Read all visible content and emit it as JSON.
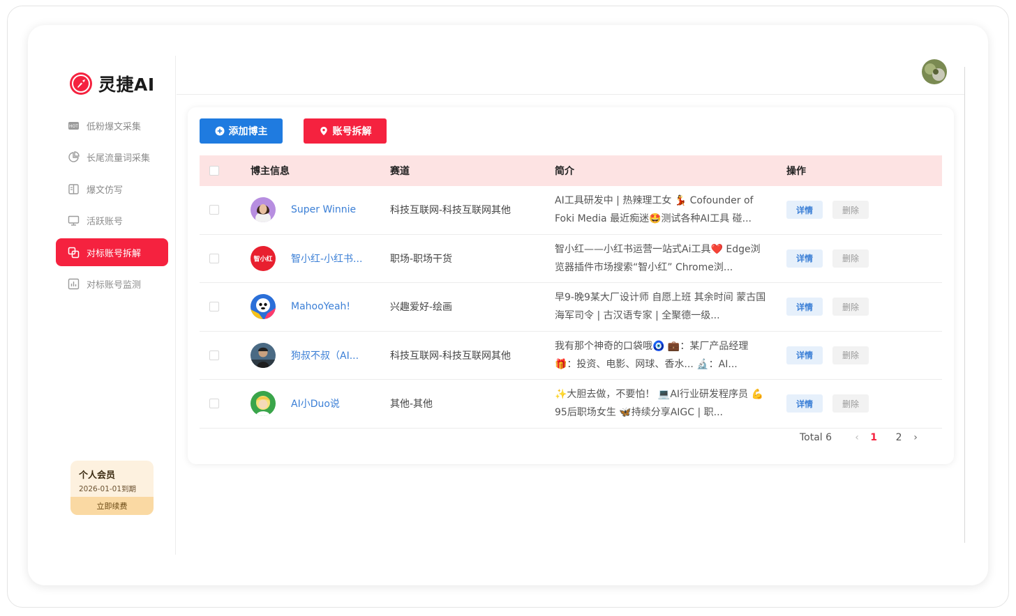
{
  "app": {
    "logo_text": "灵捷AI",
    "brand_color": "#f5223f"
  },
  "sidebar": {
    "items": [
      {
        "label": "低粉爆文采集",
        "icon": "hot-tag-icon",
        "active": false
      },
      {
        "label": "长尾流量词采集",
        "icon": "pie-chart-icon",
        "active": false
      },
      {
        "label": "爆文仿写",
        "icon": "book-edit-icon",
        "active": false
      },
      {
        "label": "活跃账号",
        "icon": "monitor-icon",
        "active": false
      },
      {
        "label": "对标账号拆解",
        "icon": "copy-split-icon",
        "active": true
      },
      {
        "label": "对标账号监测",
        "icon": "bar-chart-icon",
        "active": false
      }
    ],
    "member": {
      "title": "个人会员",
      "expire": "2026-01-01到期",
      "renew_label": "立即续费"
    }
  },
  "toolbar": {
    "add_label": "添加博主",
    "split_label": "账号拆解"
  },
  "table": {
    "headers": {
      "info": "博主信息",
      "track": "赛道",
      "bio": "简介",
      "ops": "操作"
    },
    "detail_label": "详情",
    "delete_label": "删除",
    "rows": [
      {
        "name": "Super Winnie",
        "track": "科技互联网-科技互联网其他",
        "bio": "AI工具研发中 | 热辣理工女 💃 Cofounder of Foki Media 最近痴迷🤩测试各种AI工具 碰..."
      },
      {
        "name": "智小红-小红书...",
        "track": "职场-职场干货",
        "bio": "智小红——小红书运营一站式Ai工具❤️ Edge浏览器插件市场搜索“智小红” Chrome浏..."
      },
      {
        "name": "MahooYeah!",
        "track": "兴趣爱好-绘画",
        "bio": "早9-晚9某大厂设计师 自愿上班 其余时间 蒙古国海军司令 | 古汉语专家 | 全聚德一级..."
      },
      {
        "name": "狗叔不叔（AI...",
        "track": "科技互联网-科技互联网其他",
        "bio": "我有那个神奇的口袋哦🧿 💼：某厂产品经理 🎁：投资、电影、网球、香水... 🔬：AI..."
      },
      {
        "name": "AI小Duo说",
        "track": "其他-其他",
        "bio": "✨大胆去做，不要怕！ 💻AI行业研发程序员 💪95后职场女生 🦋持续分享AIGC | 职..."
      }
    ],
    "avatar_badge_text": "智小红"
  },
  "pagination": {
    "total_label": "Total 6",
    "pages": [
      "1",
      "2"
    ],
    "current": "1"
  }
}
